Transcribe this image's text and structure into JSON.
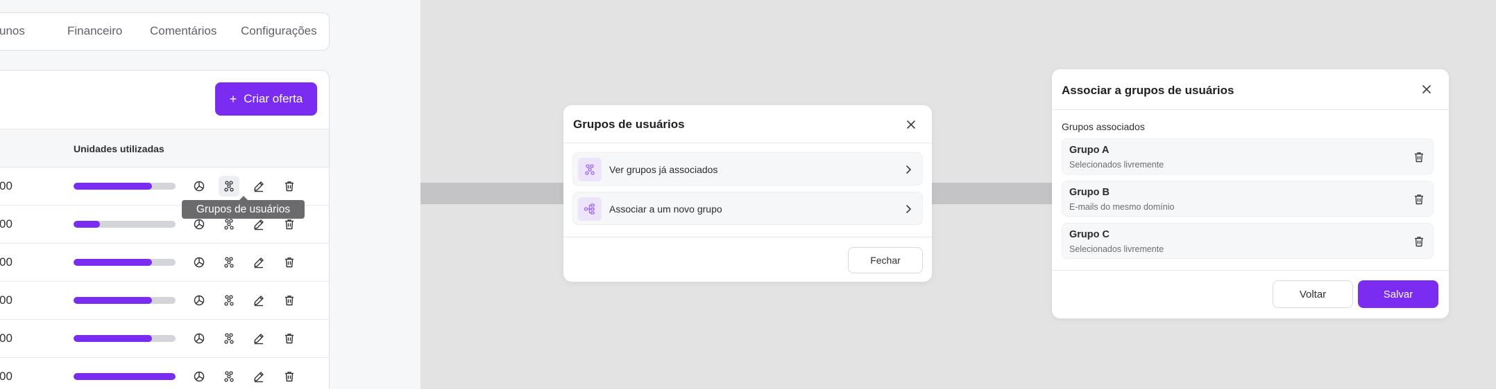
{
  "tabs": [
    "unos",
    "Financeiro",
    "Comentários",
    "Configurações"
  ],
  "offers": {
    "create_label": "Criar oferta",
    "column_units": "Unidades utilizadas",
    "rows": [
      {
        "value_tail": "00",
        "usage": 0.77
      },
      {
        "value_tail": "00",
        "usage": 0.26
      },
      {
        "value_tail": "00",
        "usage": 0.77
      },
      {
        "value_tail": "00",
        "usage": 0.77
      },
      {
        "value_tail": "00",
        "usage": 0.77
      },
      {
        "value_tail": "00",
        "usage": 1.0
      }
    ],
    "tooltip": "Grupos de usuários"
  },
  "dialog_groups": {
    "title": "Grupos de usuários",
    "options": [
      {
        "label": "Ver grupos já associados",
        "icon": "users-group-icon"
      },
      {
        "label": "Associar a um novo grupo",
        "icon": "hierarchy-icon"
      }
    ],
    "close_label": "Fechar"
  },
  "dialog_associate": {
    "title": "Associar a grupos de usuários",
    "section_label": "Grupos associados",
    "groups": [
      {
        "name": "Grupo A",
        "rule": "Selecionados livremente"
      },
      {
        "name": "Grupo B",
        "rule": "E-mails do mesmo domínio"
      },
      {
        "name": "Grupo C",
        "rule": "Selecionados livremente"
      }
    ],
    "back_label": "Voltar",
    "save_label": "Salvar"
  },
  "colors": {
    "accent": "#7a2cf0",
    "accent_soft": "#ede4fc",
    "track": "#d4d5da",
    "backdrop": "#e3e3e3"
  }
}
